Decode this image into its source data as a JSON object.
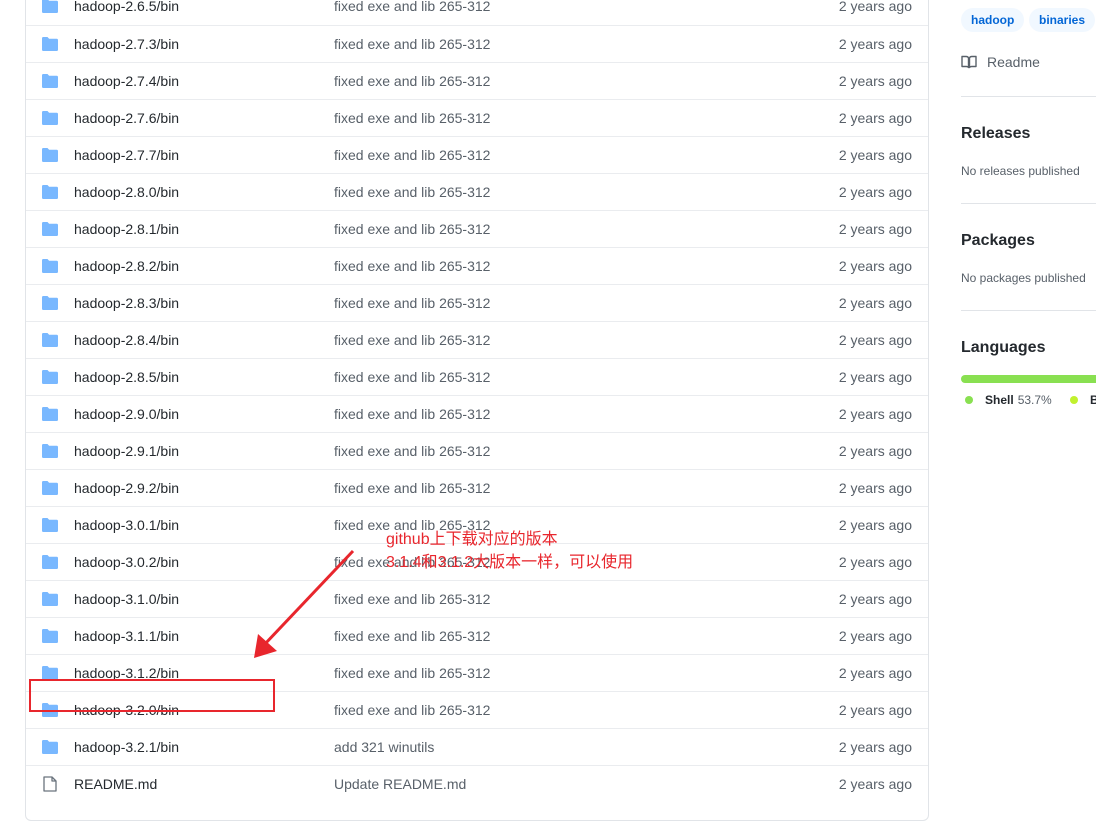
{
  "files": [
    {
      "name": "hadoop-2.6.5/bin",
      "message": "fixed exe and lib 265-312",
      "age": "2 years ago",
      "type": "folder"
    },
    {
      "name": "hadoop-2.7.3/bin",
      "message": "fixed exe and lib 265-312",
      "age": "2 years ago",
      "type": "folder"
    },
    {
      "name": "hadoop-2.7.4/bin",
      "message": "fixed exe and lib 265-312",
      "age": "2 years ago",
      "type": "folder"
    },
    {
      "name": "hadoop-2.7.6/bin",
      "message": "fixed exe and lib 265-312",
      "age": "2 years ago",
      "type": "folder"
    },
    {
      "name": "hadoop-2.7.7/bin",
      "message": "fixed exe and lib 265-312",
      "age": "2 years ago",
      "type": "folder"
    },
    {
      "name": "hadoop-2.8.0/bin",
      "message": "fixed exe and lib 265-312",
      "age": "2 years ago",
      "type": "folder"
    },
    {
      "name": "hadoop-2.8.1/bin",
      "message": "fixed exe and lib 265-312",
      "age": "2 years ago",
      "type": "folder"
    },
    {
      "name": "hadoop-2.8.2/bin",
      "message": "fixed exe and lib 265-312",
      "age": "2 years ago",
      "type": "folder"
    },
    {
      "name": "hadoop-2.8.3/bin",
      "message": "fixed exe and lib 265-312",
      "age": "2 years ago",
      "type": "folder"
    },
    {
      "name": "hadoop-2.8.4/bin",
      "message": "fixed exe and lib 265-312",
      "age": "2 years ago",
      "type": "folder"
    },
    {
      "name": "hadoop-2.8.5/bin",
      "message": "fixed exe and lib 265-312",
      "age": "2 years ago",
      "type": "folder"
    },
    {
      "name": "hadoop-2.9.0/bin",
      "message": "fixed exe and lib 265-312",
      "age": "2 years ago",
      "type": "folder"
    },
    {
      "name": "hadoop-2.9.1/bin",
      "message": "fixed exe and lib 265-312",
      "age": "2 years ago",
      "type": "folder"
    },
    {
      "name": "hadoop-2.9.2/bin",
      "message": "fixed exe and lib 265-312",
      "age": "2 years ago",
      "type": "folder"
    },
    {
      "name": "hadoop-3.0.1/bin",
      "message": "fixed exe and lib 265-312",
      "age": "2 years ago",
      "type": "folder"
    },
    {
      "name": "hadoop-3.0.2/bin",
      "message": "fixed exe and lib 265-312",
      "age": "2 years ago",
      "type": "folder"
    },
    {
      "name": "hadoop-3.1.0/bin",
      "message": "fixed exe and lib 265-312",
      "age": "2 years ago",
      "type": "folder"
    },
    {
      "name": "hadoop-3.1.1/bin",
      "message": "fixed exe and lib 265-312",
      "age": "2 years ago",
      "type": "folder"
    },
    {
      "name": "hadoop-3.1.2/bin",
      "message": "fixed exe and lib 265-312",
      "age": "2 years ago",
      "type": "folder"
    },
    {
      "name": "hadoop-3.2.0/bin",
      "message": "fixed exe and lib 265-312",
      "age": "2 years ago",
      "type": "folder"
    },
    {
      "name": "hadoop-3.2.1/bin",
      "message": "add 321 winutils",
      "age": "2 years ago",
      "type": "folder"
    },
    {
      "name": "README.md",
      "message": "Update README.md",
      "age": "2 years ago",
      "type": "file"
    }
  ],
  "sidebar": {
    "topics": [
      "hadoop",
      "binaries"
    ],
    "readme_label": "Readme",
    "releases": {
      "title": "Releases",
      "sub": "No releases published"
    },
    "packages": {
      "title": "Packages",
      "sub": "No packages published"
    },
    "languages": {
      "title": "Languages",
      "items": [
        {
          "name": "Shell",
          "percent": "53.7%",
          "color": "#89e051"
        },
        {
          "name": "B",
          "percent": "",
          "color": "#c1f12e"
        }
      ]
    }
  },
  "annotation": {
    "line1": "github上下载对应的版本",
    "line2": "3.1.4和3.1.2大版本一样，可以使用",
    "color": "#e8262d",
    "highlight_row": 18
  },
  "colors": {
    "folder": "#79b8ff",
    "file_icon": "#6a737d",
    "link": "#0366d6"
  }
}
